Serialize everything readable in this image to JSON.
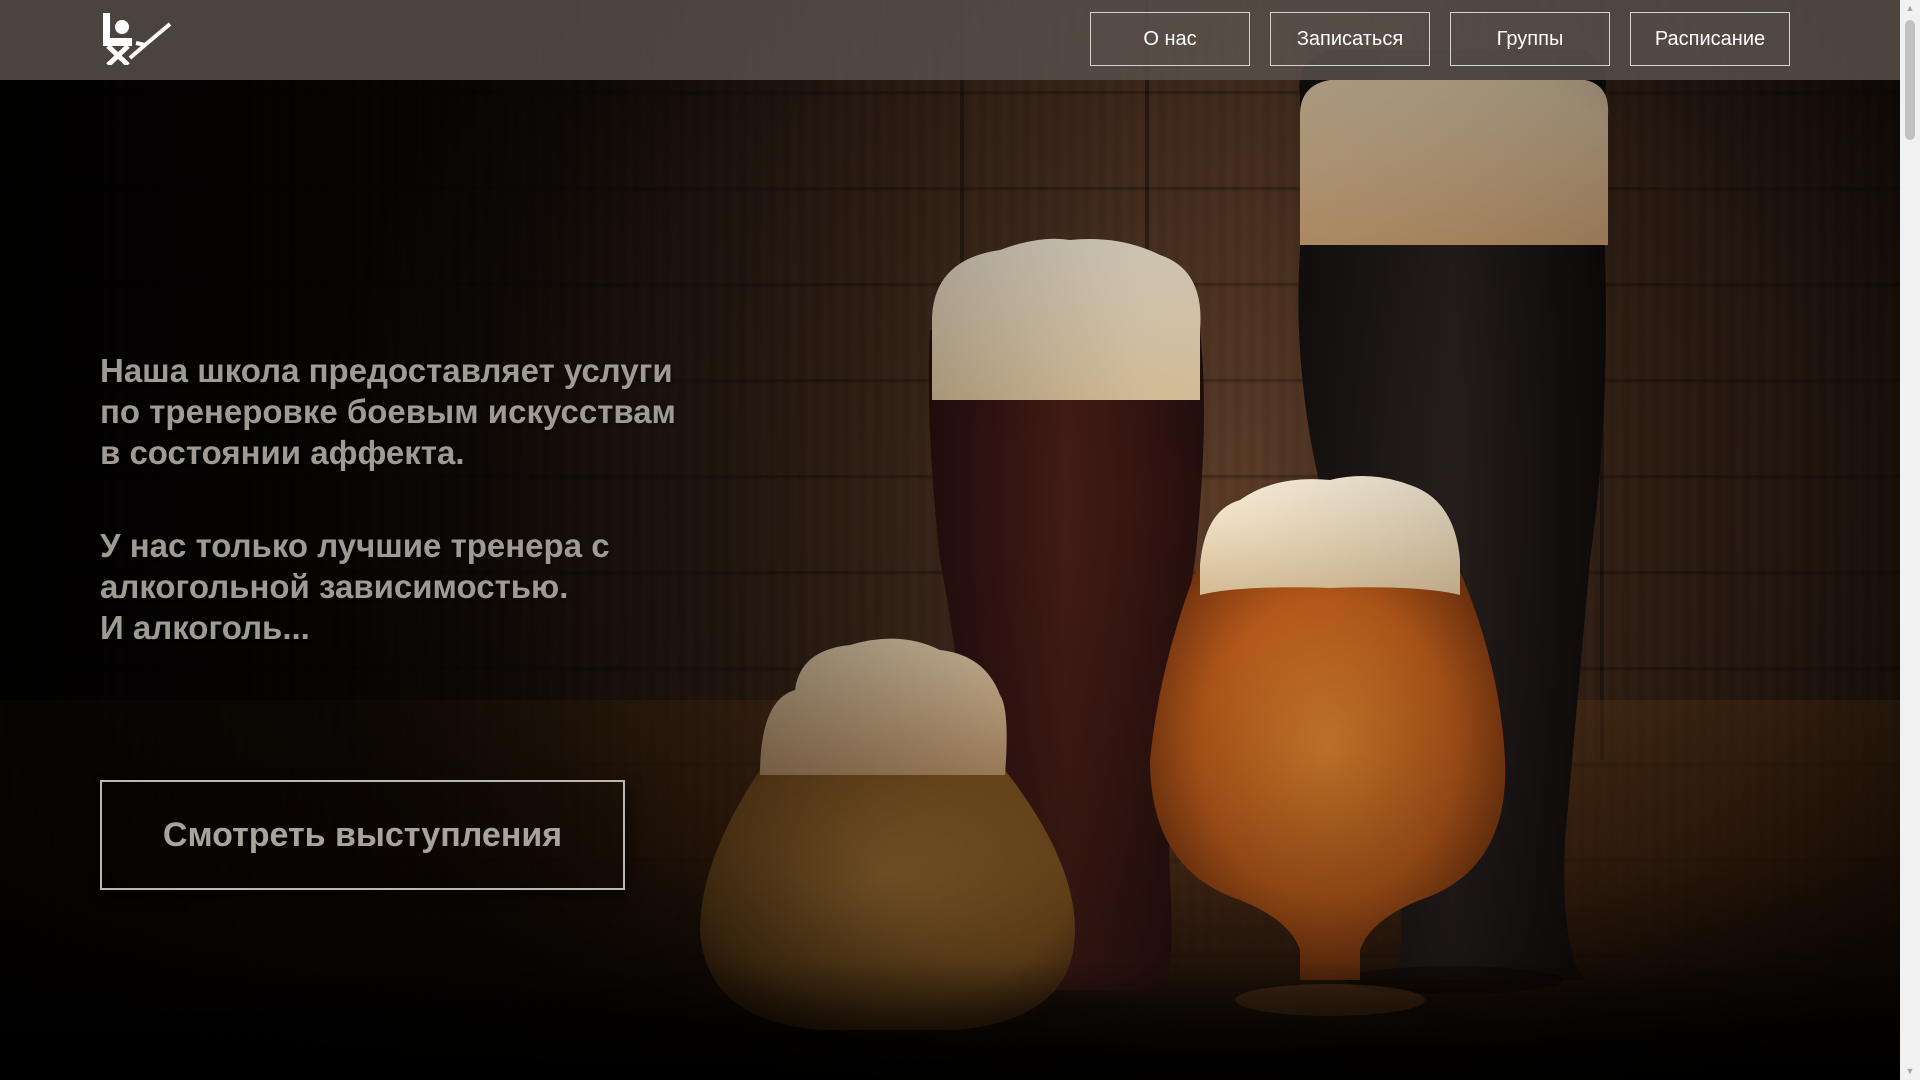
{
  "header": {
    "logo_icon": "logo-bar-stool-drink-icon",
    "nav": [
      {
        "label": "О нас"
      },
      {
        "label": "Записаться"
      },
      {
        "label": "Группы"
      },
      {
        "label": "Расписание"
      }
    ]
  },
  "hero": {
    "paragraph1": "Наша школа предоставляет услуги по тренеровке боевым искусствам в состоянии аффекта.",
    "paragraph2_line1": "У нас только лучшие тренера с алкогольной зависимостью.",
    "paragraph2_line2": "И алкоголь...",
    "cta_label": "Смотреть выступления"
  },
  "background": {
    "image": "beer-glasses-on-wooden-table",
    "colors": {
      "wood_dark": "#2a1a10",
      "amber": "#c8641a",
      "foam": "#f2e2c8",
      "stout": "#1e1614"
    }
  },
  "scrollbar": {
    "up_icon": "scroll-up-arrow-icon",
    "down_icon": "scroll-down-arrow-icon"
  }
}
